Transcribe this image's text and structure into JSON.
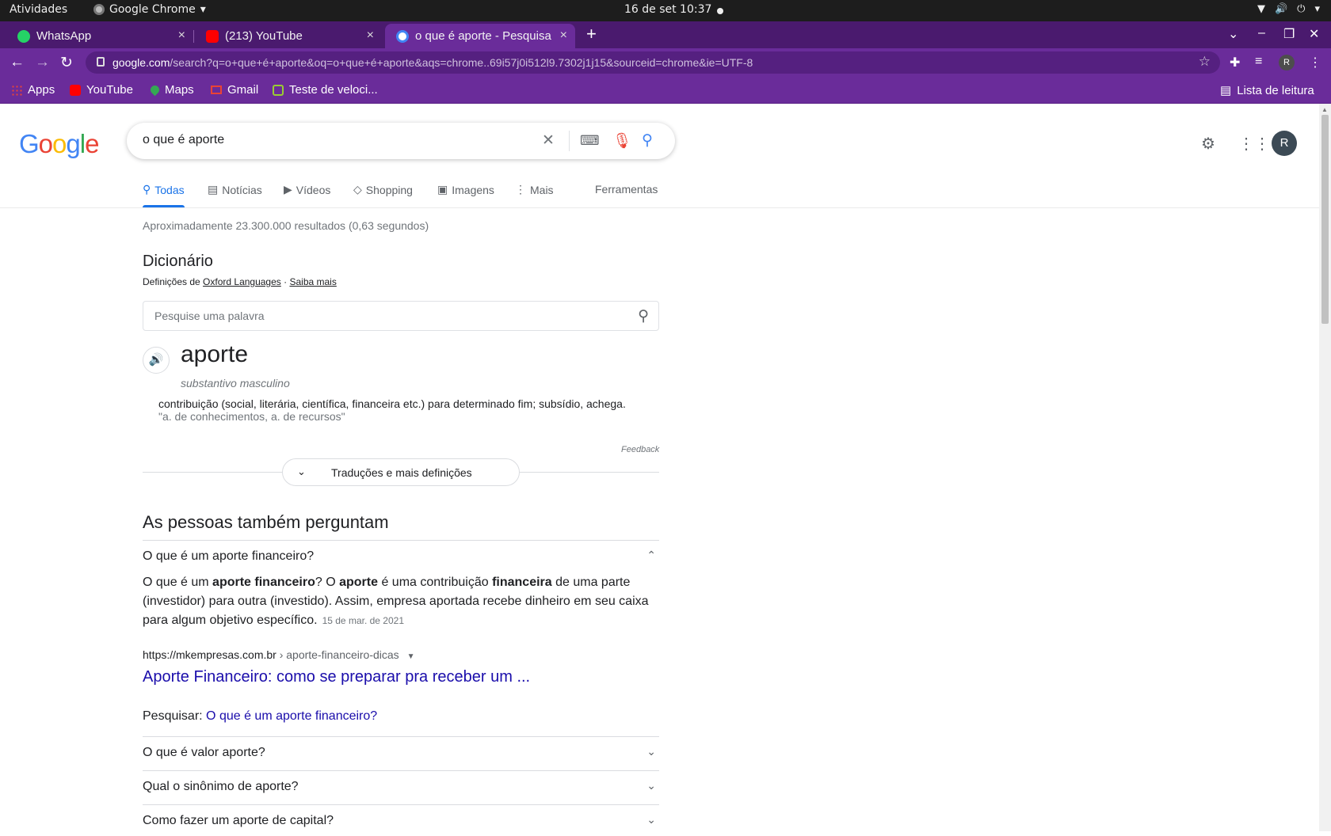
{
  "os": {
    "activities": "Atividades",
    "app_name": "Google Chrome",
    "clock": "16 de set  10:37"
  },
  "tabs": [
    {
      "title": "WhatsApp",
      "close": "×"
    },
    {
      "title": "(213) YouTube",
      "close": "×"
    },
    {
      "title": "o que é aporte - Pesquisa",
      "close": "×"
    }
  ],
  "new_tab": "+",
  "address": {
    "host": "google.com",
    "path": "/search?q=o+que+é+aporte&oq=o+que+é+aporte&aqs=chrome..69i57j0i512l9.7302j1j15&sourceid=chrome&ie=UTF-8"
  },
  "profile_initial": "R",
  "bookmarks": {
    "apps": "Apps",
    "youtube": "YouTube",
    "maps": "Maps",
    "gmail": "Gmail",
    "speedtest": "Teste de veloci...",
    "reading_list": "Lista de leitura"
  },
  "google": {
    "logo": "Google",
    "query": "o que é aporte",
    "avatar": "R",
    "tabs": {
      "all": "Todas",
      "news": "Notícias",
      "videos": "Vídeos",
      "shopping": "Shopping",
      "images": "Imagens",
      "more": "Mais",
      "tools": "Ferramentas"
    },
    "stats": "Aproximadamente 23.300.000 resultados (0,63 segundos)"
  },
  "dictionary": {
    "title": "Dicionário",
    "source_prefix": "Definições de ",
    "source_link": "Oxford Languages",
    "source_sep": " · ",
    "learn_more": "Saiba mais",
    "search_placeholder": "Pesquise uma palavra",
    "word": "aporte",
    "part_of_speech": "substantivo masculino",
    "definition": "contribuição (social, literária, científica, financeira etc.) para determinado fim; subsídio, achega.",
    "example": "\"a. de conhecimentos, a. de recursos\"",
    "feedback": "Feedback",
    "more_button": "Traduções e mais definições"
  },
  "people_also_ask": {
    "title": "As pessoas também perguntam",
    "expanded_question": "O que é um aporte financeiro?",
    "answer": {
      "p1": "O que é um ",
      "b1": "aporte financeiro",
      "p2": "? O ",
      "b2": "aporte",
      "p3": " é uma contribuição ",
      "b3": "financeira",
      "p4": " de uma parte (investidor) para outra (investido). Assim, empresa aportada recebe dinheiro em seu caixa para algum objetivo específico.",
      "date": "15 de mar. de 2021"
    },
    "cite_url": "https://mkempresas.com.br",
    "cite_path": " › aporte-financeiro-dicas",
    "result_title": "Aporte Financeiro: como se preparar pra receber um ...",
    "search_label": "Pesquisar: ",
    "search_link": "O que é um aporte financeiro?",
    "questions": [
      "O que é valor aporte?",
      "Qual o sinônimo de aporte?",
      "Como fazer um aporte de capital?"
    ]
  }
}
